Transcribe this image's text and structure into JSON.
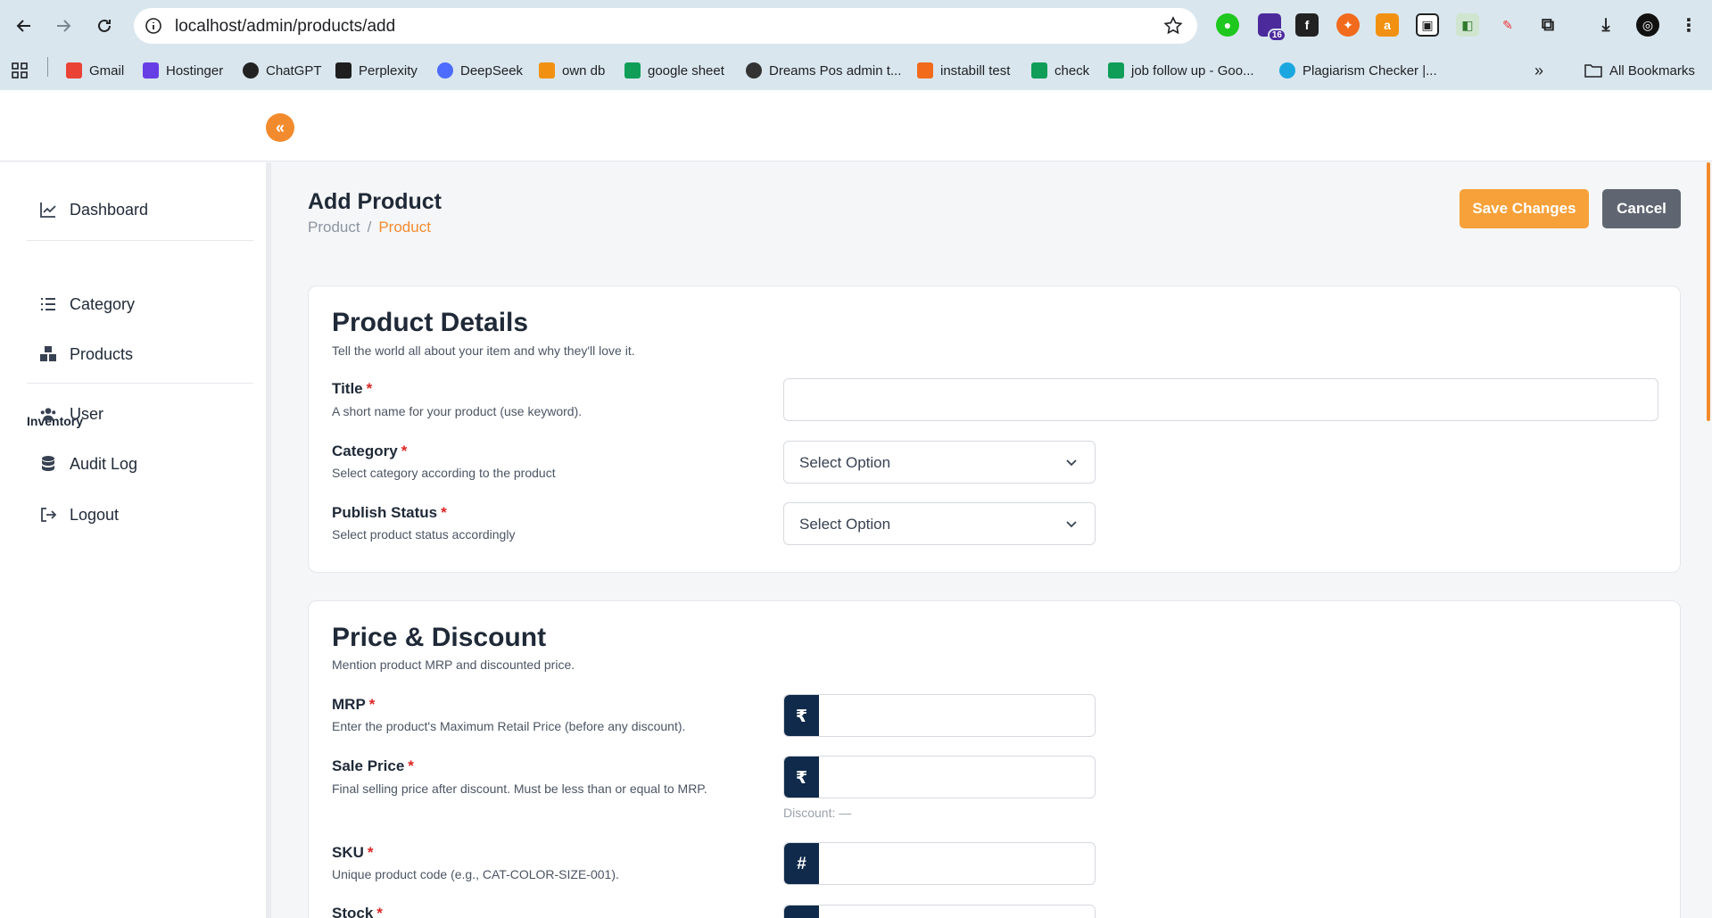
{
  "browser": {
    "url": "localhost/admin/products/add",
    "ext_badge": "16",
    "bookmarks": [
      {
        "label": "Gmail",
        "color": "#ea4335"
      },
      {
        "label": "Hostinger",
        "color": "#673de6"
      },
      {
        "label": "ChatGPT",
        "color": "#222222"
      },
      {
        "label": "Perplexity",
        "color": "#1f1f1f"
      },
      {
        "label": "DeepSeek",
        "color": "#4d6bfe"
      },
      {
        "label": "own db",
        "color": "#f29111"
      },
      {
        "label": "google sheet",
        "color": "#0f9d58"
      },
      {
        "label": "Dreams Pos admin t...",
        "color": "#333333"
      },
      {
        "label": "instabill test",
        "color": "#f26b1d"
      },
      {
        "label": "check",
        "color": "#0f9d58"
      },
      {
        "label": "job follow up - Goo...",
        "color": "#0f9d58"
      },
      {
        "label": "Plagiarism Checker |...",
        "color": "#1aa7e0"
      }
    ],
    "more_label": "»",
    "all_bookmarks": "All Bookmarks"
  },
  "sidebar": {
    "dashboard": "Dashboard",
    "section_inventory": "Inventory",
    "category": "Category",
    "products": "Products",
    "user": "User",
    "audit_log": "Audit Log",
    "logout": "Logout"
  },
  "page": {
    "title": "Add Product",
    "breadcrumb": [
      "Product",
      "/",
      "Product"
    ],
    "save_label": "Save Changes",
    "cancel_label": "Cancel"
  },
  "product_details": {
    "title": "Product Details",
    "subtitle": "Tell the world all about your item and why they'll love it.",
    "title_field": {
      "label": "Title",
      "required": "*",
      "help": "A short name for your product (use keyword).",
      "value": ""
    },
    "category_field": {
      "label": "Category",
      "required": "*",
      "help": "Select category according to the product",
      "selected": "Select Option"
    },
    "status_field": {
      "label": "Publish Status",
      "required": "*",
      "help": "Select product status accordingly",
      "selected": "Select Option"
    }
  },
  "price_discount": {
    "title": "Price & Discount",
    "subtitle": "Mention product MRP and discounted price.",
    "mrp": {
      "label": "MRP",
      "required": "*",
      "help": "Enter the product's Maximum Retail Price (before any discount).",
      "prefix": "₹",
      "value": ""
    },
    "sale_price": {
      "label": "Sale Price",
      "required": "*",
      "help": "Final selling price after discount. Must be less than or equal to MRP.",
      "prefix": "₹",
      "value": "",
      "discount_text": "Discount: —"
    },
    "sku": {
      "label": "SKU",
      "required": "*",
      "help": "Unique product code (e.g., CAT-COLOR-SIZE-001).",
      "prefix": "#",
      "value": ""
    },
    "stock": {
      "label": "Stock",
      "required": "*",
      "prefix": "#"
    }
  },
  "colors": {
    "accent": "#f28b2d",
    "save": "#f7a13a",
    "cancel": "#5f6671",
    "prefix": "#0f2a4a",
    "required": "#dc2626"
  }
}
